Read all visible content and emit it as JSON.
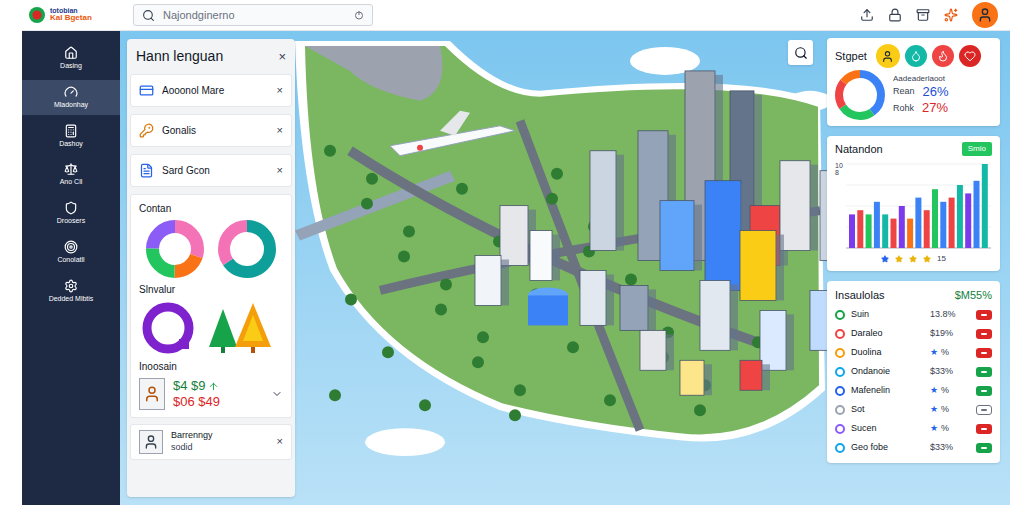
{
  "topbar": {
    "logo": [
      "totobian",
      "Kal Bgetan"
    ],
    "search": {
      "placeholder": "Najondginerno"
    }
  },
  "sidebar": {
    "items": [
      {
        "label": "Dasing",
        "selected": false
      },
      {
        "label": "Mladonhay",
        "selected": true
      },
      {
        "label": "Dashoy",
        "selected": false
      },
      {
        "label": "Ano Cll",
        "selected": false
      },
      {
        "label": "Droosers",
        "selected": false
      },
      {
        "label": "Conolatll",
        "selected": false
      },
      {
        "label": "Dedded Mlbtis",
        "selected": false
      }
    ]
  },
  "left_panel": {
    "title": "Hann lenguan",
    "close": "×",
    "filters": [
      {
        "label": "Aooonol Mare",
        "close": "×"
      },
      {
        "label": "Gonalis",
        "close": "×"
      },
      {
        "label": "Sard Gcon",
        "close": "×"
      }
    ],
    "charts_card": {
      "title": "Contan",
      "donuts": [
        {
          "values": [
            30,
            20,
            25,
            25
          ],
          "colors": [
            "#f472b6",
            "#f97316",
            "#22c55e",
            "#8b5cf6"
          ]
        },
        {
          "values": [
            65,
            35
          ],
          "colors": [
            "#0e9f9a",
            "#f472b6"
          ]
        }
      ],
      "subtitle": "Slnvalur"
    },
    "income": {
      "title": "Inoosain",
      "up": "$4 $9",
      "down": "$06 $49"
    },
    "person": {
      "name": "Barrenngy",
      "sub": "sodid",
      "close": "×"
    }
  },
  "stats_card": {
    "title": "Stgpet",
    "caption": "Aadeaderlaoot",
    "donut": {
      "values": [
        40,
        25,
        20,
        15
      ],
      "colors": [
        "#3b82f6",
        "#22c55e",
        "#ef4444",
        "#f97316"
      ]
    },
    "rows": [
      {
        "label": "Rean",
        "value": "26%",
        "color": "#1d4ed8"
      },
      {
        "label": "Rohk",
        "value": "27%",
        "color": "#dc2626"
      }
    ]
  },
  "bar_card": {
    "title": "Natandon",
    "badge": "Smio",
    "y_ticks": [
      "10",
      "8"
    ],
    "values": [
      4,
      4.5,
      4,
      5.5,
      4,
      3.5,
      5,
      3.5,
      6,
      4.5,
      7,
      5.5,
      6,
      7.5,
      6.5,
      8,
      10
    ],
    "colors": [
      "#7c3aed",
      "#ef4444",
      "#22c55e",
      "#3b82f6",
      "#14b8a6",
      "#ef4444",
      "#7c3aed",
      "#f97316",
      "#3b82f6",
      "#ef4444",
      "#22c55e",
      "#3b82f6",
      "#ef4444",
      "#14b8a6",
      "#7c3aed",
      "#3b82f6",
      "#14b8a6"
    ],
    "stars": 4,
    "rating_count": "15"
  },
  "table": {
    "title": "Insaulolas",
    "total": "$M55%",
    "rows": [
      {
        "name": "Suin",
        "value": "13.8%",
        "color": "#16a34a",
        "badge_color": "#dc2626",
        "badge_outline": false
      },
      {
        "name": "Daraleo",
        "value": "$19%",
        "color": "#ef4444",
        "badge_color": "#dc2626",
        "badge_outline": false
      },
      {
        "name": "Duolina",
        "mark": "★",
        "value": "%",
        "color": "#f59e0b",
        "badge_color": "#dc2626",
        "badge_outline": false
      },
      {
        "name": "Ondanoie",
        "value": "$33%",
        "color": "#0ea5e9",
        "badge_color": "#16a34a",
        "badge_outline": false
      },
      {
        "name": "Mafenelin",
        "mark": "★",
        "value": "%",
        "color": "#2563eb",
        "badge_color": "#16a34a",
        "badge_outline": false
      },
      {
        "name": "Sot",
        "mark": "★",
        "value": "%",
        "color": "#9ca3af",
        "badge_color": "#6b7280",
        "badge_outline": true
      },
      {
        "name": "Sucen",
        "mark": "★",
        "value": "%",
        "color": "#8b5cf6",
        "badge_color": "#dc2626",
        "badge_outline": false
      },
      {
        "name": "Geo fobe",
        "value": "$33%",
        "color": "#0ea5e9",
        "badge_color": "#16a34a",
        "badge_outline": false
      }
    ]
  }
}
